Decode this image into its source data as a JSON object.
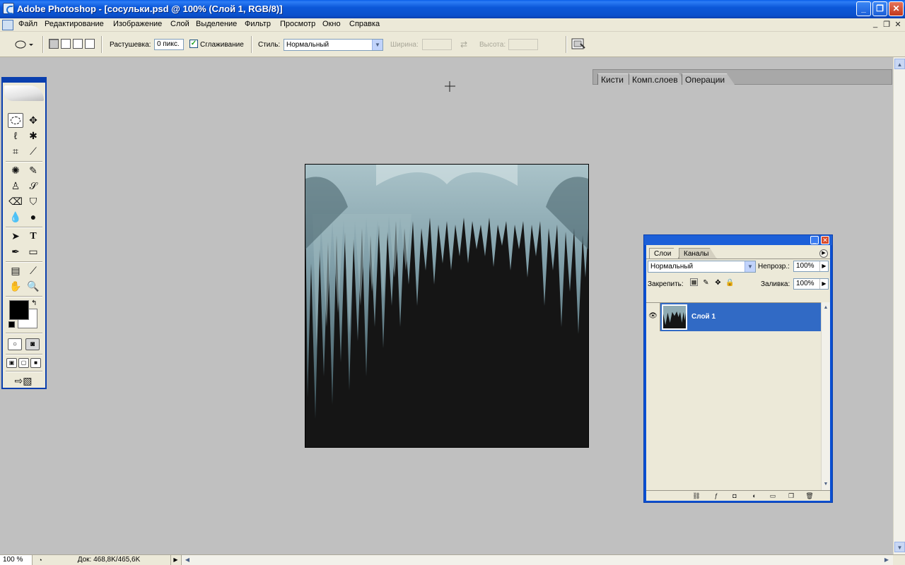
{
  "window": {
    "title": "Adobe Photoshop - [сосульки.psd @ 100% (Слой 1, RGB/8)]",
    "minimize": "_",
    "maximize": "❐",
    "close": "✕"
  },
  "menu": {
    "items": [
      "Файл",
      "Редактирование",
      "Изображение",
      "Слой",
      "Выделение",
      "Фильтр",
      "Просмотр",
      "Окно",
      "Справка"
    ],
    "doc_minimize": "_",
    "doc_restore": "❐",
    "doc_close": "✕"
  },
  "options": {
    "feather_label": "Растушевка:",
    "feather_value": "0 пикс.",
    "antialias_label": "Сглаживание",
    "antialias_checked": true,
    "style_label": "Стиль:",
    "style_value": "Нормальный",
    "width_label": "Ширина:",
    "height_label": "Высота:"
  },
  "palette_well": {
    "tabs": [
      "Кисти",
      "Комп.слоев",
      "Операции"
    ]
  },
  "layers_panel": {
    "tabs": [
      "Слои",
      "Каналы"
    ],
    "active_tab": "Слои",
    "blend_mode": "Нормальный",
    "opacity_label": "Непрозр.:",
    "opacity_value": "100%",
    "lock_label": "Закрепить:",
    "fill_label": "Заливка:",
    "fill_value": "100%",
    "layers": [
      {
        "name": "Слой 1",
        "visible": true,
        "selected": true
      }
    ]
  },
  "status": {
    "zoom": "100 %",
    "doc_info": "Док: 468,8K/465,6K"
  },
  "colors": {
    "foreground": "#000000",
    "background": "#ffffff",
    "selection_highlight": "#316ac5",
    "workspace": "#c0c0c0"
  }
}
